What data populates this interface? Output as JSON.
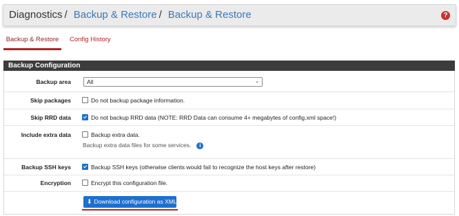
{
  "breadcrumb": {
    "items": [
      "Diagnostics",
      "Backup & Restore",
      "Backup & Restore"
    ],
    "separator": "/"
  },
  "help_icon": "question-circle-icon",
  "tabs": [
    {
      "label": "Backup & Restore",
      "active": true
    },
    {
      "label": "Config History",
      "active": false
    }
  ],
  "panel": {
    "title": "Backup Configuration",
    "rows": {
      "backup_area": {
        "label": "Backup area",
        "value": "All"
      },
      "skip_packages": {
        "label": "Skip packages",
        "checked": false,
        "text": "Do not backup package information."
      },
      "skip_rrd": {
        "label": "Skip RRD data",
        "checked": true,
        "text": "Do not backup RRD data (NOTE: RRD Data can consume 4+ megabytes of config.xml space!)"
      },
      "extra_data": {
        "label": "Include extra data",
        "checked": false,
        "text": "Backup extra data.",
        "help": "Backup extra data files for some services."
      },
      "ssh_keys": {
        "label": "Backup SSH keys",
        "checked": true,
        "text": "Backup SSH keys (otherwise clients would fail to recognize the host keys after restore)"
      },
      "encryption": {
        "label": "Encryption",
        "checked": false,
        "text": "Encrypt this configuration file."
      }
    },
    "download_button": "Download configuration as XML"
  },
  "colors": {
    "accent_red": "#b02424",
    "primary_blue": "#1e6fcf",
    "panel_header": "#3c3c3c",
    "link": "#3a78b8"
  }
}
